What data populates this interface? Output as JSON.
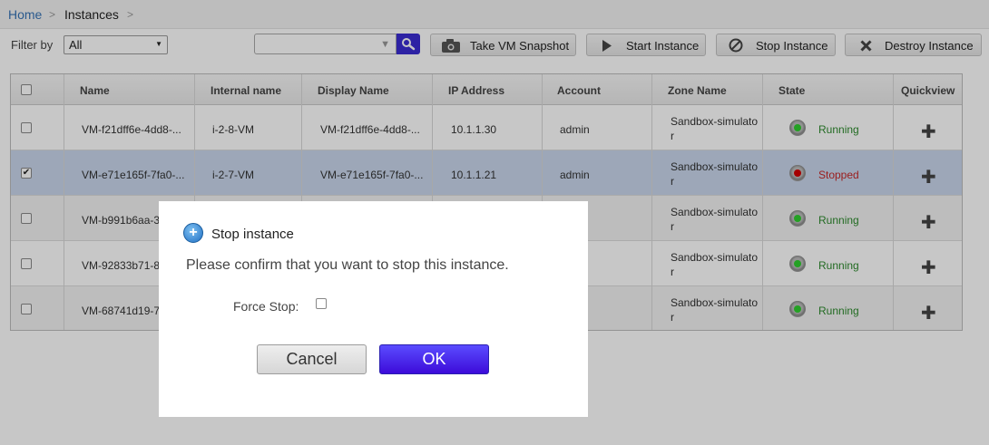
{
  "breadcrumb": {
    "home": "Home",
    "separator": ">",
    "current": "Instances"
  },
  "toolbar": {
    "filter_label": "Filter by",
    "filter_value": "All",
    "search_value": "",
    "snapshot_label": "Take VM Snapshot",
    "start_label": "Start Instance",
    "stop_label": "Stop Instance",
    "destroy_label": "Destroy Instance",
    "icons": [
      "camera-icon",
      "play-icon",
      "stop-circle-icon",
      "close-x-icon",
      "search-icon"
    ],
    "search_button_color": "#3a2cd3"
  },
  "grid": {
    "columns": [
      "Name",
      "Internal name",
      "Display Name",
      "IP Address",
      "Account",
      "Zone Name",
      "State",
      "Quickview"
    ],
    "rows": [
      {
        "name": "VM-f21dff6e-4dd8-...",
        "internal": "i-2-8-VM",
        "display": "VM-f21dff6e-4dd8-...",
        "ip": "10.1.1.30",
        "account": "admin",
        "zone": "Sandbox-simulator",
        "state": "Running",
        "checked": false,
        "selected": false
      },
      {
        "name": "VM-e71e165f-7fa0-...",
        "internal": "i-2-7-VM",
        "display": "VM-e71e165f-7fa0-...",
        "ip": "10.1.1.21",
        "account": "admin",
        "zone": "Sandbox-simulator",
        "state": "Stopped",
        "checked": true,
        "selected": true
      },
      {
        "name": "VM-b991b6aa-3",
        "internal": "",
        "display": "",
        "ip": "",
        "account": "",
        "zone": "Sandbox-simulator",
        "state": "Running",
        "checked": false,
        "selected": false
      },
      {
        "name": "VM-92833b71-8",
        "internal": "",
        "display": "",
        "ip": "",
        "account": "",
        "zone": "Sandbox-simulator",
        "state": "Running",
        "checked": false,
        "selected": false
      },
      {
        "name": "VM-68741d19-7",
        "internal": "",
        "display": "",
        "ip": "",
        "account": "",
        "zone": "Sandbox-simulator",
        "state": "Running",
        "checked": false,
        "selected": false
      }
    ],
    "colors": {
      "running": "#2d8a2d",
      "stopped": "#c62828",
      "selected_row": "#c9d7ec"
    }
  },
  "dialog": {
    "title": "Stop instance",
    "message": "Please confirm that you want to stop this instance.",
    "force_stop_label": "Force Stop:",
    "force_stop_checked": false,
    "cancel_label": "Cancel",
    "ok_label": "OK",
    "ok_color": "#3d0bd9"
  }
}
